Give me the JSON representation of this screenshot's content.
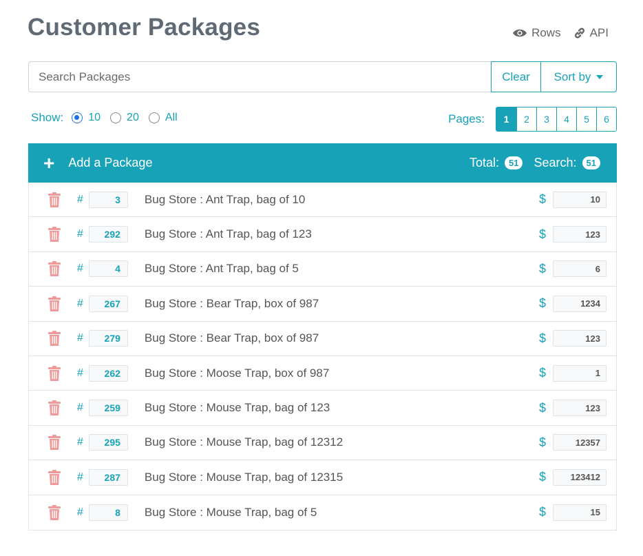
{
  "page": {
    "title": "Customer Packages",
    "links": {
      "rows_label": "Rows",
      "api_label": "API"
    }
  },
  "search": {
    "placeholder": "Search Packages",
    "value": "",
    "clear_label": "Clear",
    "sort_label": "Sort by"
  },
  "show": {
    "label": "Show:",
    "options": [
      "10",
      "20",
      "All"
    ],
    "selected": "10"
  },
  "pages": {
    "label": "Pages:",
    "items": [
      "1",
      "2",
      "3",
      "4",
      "5",
      "6"
    ],
    "current": "1"
  },
  "header": {
    "add_label": "Add a Package",
    "total_label": "Total:",
    "total_count": "51",
    "search_label": "Search:",
    "search_count": "51"
  },
  "packages": [
    {
      "id": "3",
      "name": "Bug Store : Ant Trap, bag of 10",
      "price": "10"
    },
    {
      "id": "292",
      "name": "Bug Store : Ant Trap, bag of 123",
      "price": "123"
    },
    {
      "id": "4",
      "name": "Bug Store : Ant Trap, bag of 5",
      "price": "6"
    },
    {
      "id": "267",
      "name": "Bug Store : Bear Trap, box of 987",
      "price": "1234"
    },
    {
      "id": "279",
      "name": "Bug Store : Bear Trap, box of 987",
      "price": "123"
    },
    {
      "id": "262",
      "name": "Bug Store : Moose Trap, box of 987",
      "price": "1"
    },
    {
      "id": "259",
      "name": "Bug Store : Mouse Trap, bag of 123",
      "price": "123"
    },
    {
      "id": "295",
      "name": "Bug Store : Mouse Trap, bag of 12312",
      "price": "12357"
    },
    {
      "id": "287",
      "name": "Bug Store : Mouse Trap, bag of 12315",
      "price": "123412"
    },
    {
      "id": "8",
      "name": "Bug Store : Mouse Trap, bag of 5",
      "price": "15"
    }
  ],
  "symbols": {
    "hash": "#",
    "dollar": "$",
    "plus": "+"
  },
  "colors": {
    "accent": "#17a2b8",
    "trash": "#f19a9a",
    "title": "#5f6a75"
  },
  "icons": {
    "rows": "eye-icon",
    "api": "link-icon",
    "delete": "trash-icon",
    "add": "plus-icon"
  }
}
